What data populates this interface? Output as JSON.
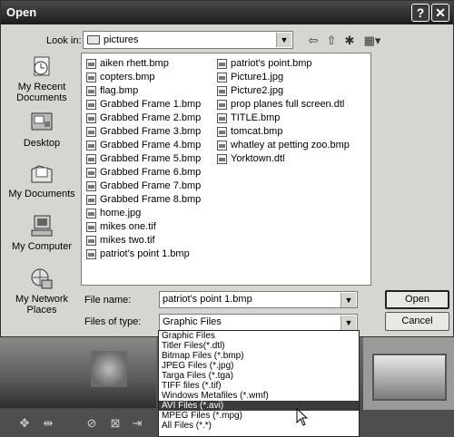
{
  "dialog": {
    "title": "Open",
    "help_btn": "?",
    "close_btn": "✕"
  },
  "lookin": {
    "label": "Look in:",
    "value": "pictures"
  },
  "places": [
    {
      "label": "My Recent Documents",
      "icon": "recent-documents-icon"
    },
    {
      "label": "Desktop",
      "icon": "desktop-icon"
    },
    {
      "label": "My Documents",
      "icon": "my-documents-icon"
    },
    {
      "label": "My Computer",
      "icon": "my-computer-icon"
    },
    {
      "label": "My Network Places",
      "icon": "network-places-icon"
    }
  ],
  "files_col1": [
    "aiken rhett.bmp",
    "copters.bmp",
    "flag.bmp",
    "Grabbed Frame 1.bmp",
    "Grabbed Frame 2.bmp",
    "Grabbed Frame 3.bmp",
    "Grabbed Frame 4.bmp",
    "Grabbed Frame 5.bmp",
    "Grabbed Frame 6.bmp",
    "Grabbed Frame 7.bmp",
    "Grabbed Frame 8.bmp",
    "home.jpg",
    "mikes one.tif",
    "mikes two.tif",
    "patriot's point 1.bmp"
  ],
  "files_col2": [
    "patriot's point.bmp",
    "Picture1.jpg",
    "Picture2.jpg",
    "prop planes full screen.dtl",
    "TITLE.bmp",
    "tomcat.bmp",
    "whatley at petting zoo.bmp",
    "Yorktown.dtl"
  ],
  "filename": {
    "label": "File name:",
    "value": "patriot's point 1.bmp"
  },
  "filetype": {
    "label": "Files of type:",
    "value": "Graphic Files",
    "options": [
      "Graphic Files",
      "Titler Files(*.dtl)",
      "Bitmap Files (*.bmp)",
      "JPEG Files (*.jpg)",
      "Targa Files (*.tga)",
      "TIFF files (*.tif)",
      "Windows Metafiles (*.wmf)",
      "AVI Files (*.avi)",
      "MPEG Files (*.mpg)",
      "All Files (*.*)"
    ],
    "highlighted_index": 7
  },
  "buttons": {
    "open": "Open",
    "cancel": "Cancel"
  }
}
